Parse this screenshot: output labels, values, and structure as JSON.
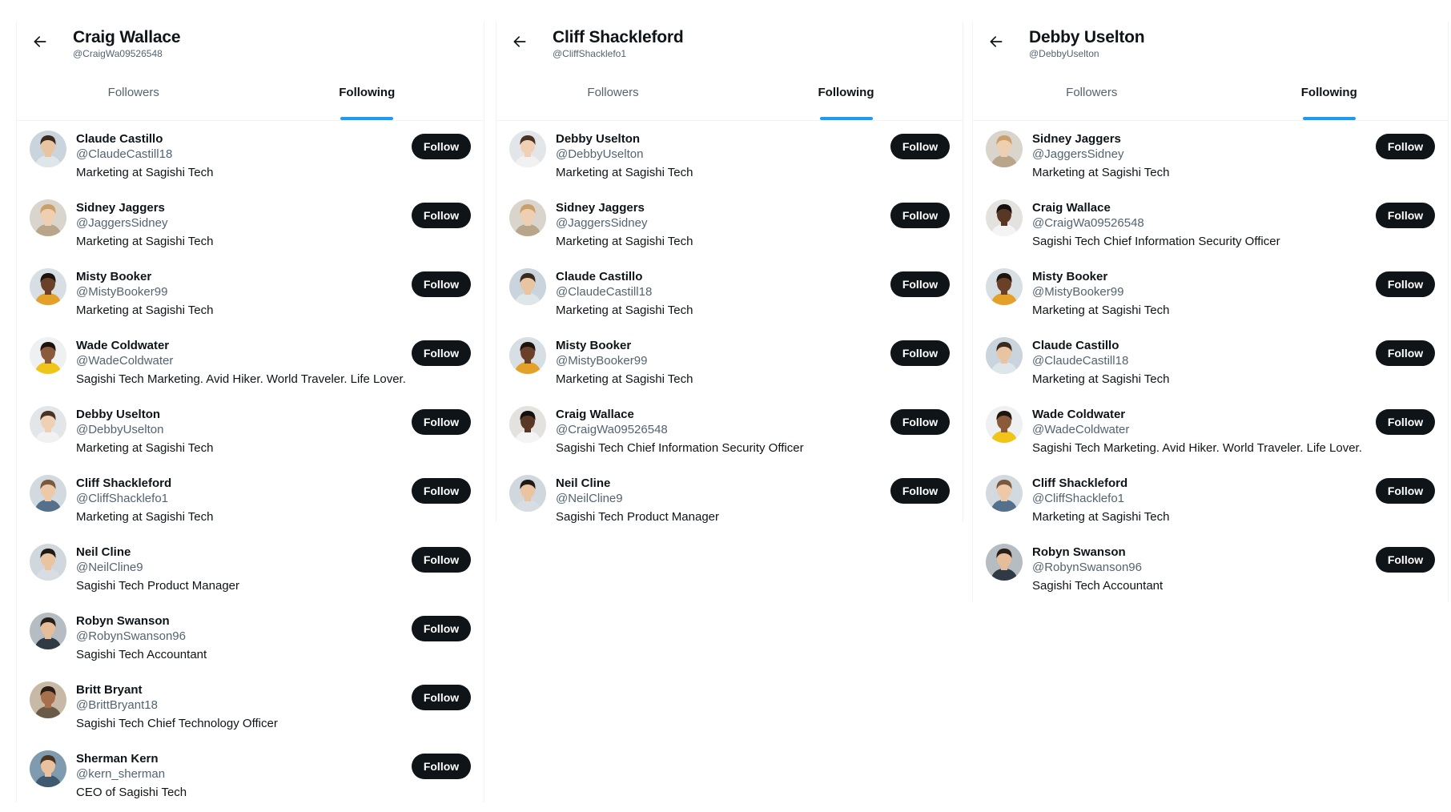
{
  "colors": {
    "accent": "#1d9bf0",
    "button_bg": "#0f1419",
    "muted_text": "#536471",
    "divider": "#eff3f4"
  },
  "panels": [
    {
      "name": "Craig Wallace",
      "handle": "@CraigWa09526548",
      "tabs": [
        {
          "label": "Followers",
          "active": false
        },
        {
          "label": "Following",
          "active": true
        }
      ],
      "users": [
        {
          "name": "Claude Castillo",
          "handle": "@ClaudeCastill18",
          "bio": "Marketing at Sagishi Tech",
          "button": "Follow",
          "avatar": {
            "skin": "#e8c4a0",
            "hair": "#3b2a1e",
            "bg": "#c9d4dc",
            "shirt": "#dfe6ea"
          }
        },
        {
          "name": "Sidney Jaggers",
          "handle": "@JaggersSidney",
          "bio": "Marketing at Sagishi Tech",
          "button": "Follow",
          "avatar": {
            "skin": "#efcfb2",
            "hair": "#c9a06a",
            "bg": "#d9d4cc",
            "shirt": "#b9a58a"
          }
        },
        {
          "name": "Misty Booker",
          "handle": "@MistyBooker99",
          "bio": "Marketing at Sagishi Tech",
          "button": "Follow",
          "avatar": {
            "skin": "#6b4028",
            "hair": "#1e140e",
            "bg": "#d8dfe4",
            "shirt": "#e3a12a"
          }
        },
        {
          "name": "Wade Coldwater",
          "handle": "@WadeColdwater",
          "bio": "Sagishi Tech Marketing. Avid Hiker. World Traveler. Life Lover.",
          "button": "Follow",
          "avatar": {
            "skin": "#8a5a3a",
            "hair": "#1e140e",
            "bg": "#eef0f2",
            "shirt": "#f0c419"
          }
        },
        {
          "name": "Debby Uselton",
          "handle": "@DebbyUselton",
          "bio": "Marketing at Sagishi Tech",
          "button": "Follow",
          "avatar": {
            "skin": "#f0d0b4",
            "hair": "#4a3224",
            "bg": "#e3e6e9",
            "shirt": "#f1f1f1"
          }
        },
        {
          "name": "Cliff Shackleford",
          "handle": "@CliffShacklefo1",
          "bio": "Marketing at Sagishi Tech",
          "button": "Follow",
          "avatar": {
            "skin": "#eec9a8",
            "hair": "#7a5a3c",
            "bg": "#d2dae0",
            "shirt": "#55708a"
          }
        },
        {
          "name": "Neil Cline",
          "handle": "@NeilCline9",
          "bio": "Sagishi Tech Product Manager",
          "button": "Follow",
          "avatar": {
            "skin": "#e9c49e",
            "hair": "#1f1a16",
            "bg": "#d0d8de",
            "shirt": "#d7dde2"
          }
        },
        {
          "name": "Robyn Swanson",
          "handle": "@RobynSwanson96",
          "bio": "Sagishi Tech Accountant",
          "button": "Follow",
          "avatar": {
            "skin": "#e6bd99",
            "hair": "#2a1f18",
            "bg": "#b5bcc2",
            "shirt": "#2f3a44"
          }
        },
        {
          "name": "Britt Bryant",
          "handle": "@BrittBryant18",
          "bio": "Sagishi Tech Chief Technology Officer",
          "button": "Follow",
          "avatar": {
            "skin": "#a86f4c",
            "hair": "#2a1d15",
            "bg": "#c7b9a6",
            "shirt": "#6b5a48"
          }
        },
        {
          "name": "Sherman Kern",
          "handle": "@kern_sherman",
          "bio": "CEO of Sagishi Tech",
          "button": "Follow",
          "avatar": {
            "skin": "#e8c29e",
            "hair": "#4a3322",
            "bg": "#7f9bb0",
            "shirt": "#3f5a70"
          }
        }
      ]
    },
    {
      "name": "Cliff Shackleford",
      "handle": "@CliffShacklefo1",
      "tabs": [
        {
          "label": "Followers",
          "active": false
        },
        {
          "label": "Following",
          "active": true
        }
      ],
      "users": [
        {
          "name": "Debby Uselton",
          "handle": "@DebbyUselton",
          "bio": "Marketing at Sagishi Tech",
          "button": "Follow",
          "avatar": {
            "skin": "#f0d0b4",
            "hair": "#4a3224",
            "bg": "#e3e6e9",
            "shirt": "#f1f1f1"
          }
        },
        {
          "name": "Sidney Jaggers",
          "handle": "@JaggersSidney",
          "bio": "Marketing at Sagishi Tech",
          "button": "Follow",
          "avatar": {
            "skin": "#efcfb2",
            "hair": "#c9a06a",
            "bg": "#d9d4cc",
            "shirt": "#b9a58a"
          }
        },
        {
          "name": "Claude Castillo",
          "handle": "@ClaudeCastill18",
          "bio": "Marketing at Sagishi Tech",
          "button": "Follow",
          "avatar": {
            "skin": "#e8c4a0",
            "hair": "#3b2a1e",
            "bg": "#c9d4dc",
            "shirt": "#dfe6ea"
          }
        },
        {
          "name": "Misty Booker",
          "handle": "@MistyBooker99",
          "bio": "Marketing at Sagishi Tech",
          "button": "Follow",
          "avatar": {
            "skin": "#6b4028",
            "hair": "#1e140e",
            "bg": "#d8dfe4",
            "shirt": "#e3a12a"
          }
        },
        {
          "name": "Craig Wallace",
          "handle": "@CraigWa09526548",
          "bio": "Sagishi Tech Chief Information Security Officer",
          "button": "Follow",
          "avatar": {
            "skin": "#5a3624",
            "hair": "#151010",
            "bg": "#e4e2de",
            "shirt": "#f4f4f4"
          }
        },
        {
          "name": "Neil Cline",
          "handle": "@NeilCline9",
          "bio": "Sagishi Tech Product Manager",
          "button": "Follow",
          "avatar": {
            "skin": "#e9c49e",
            "hair": "#1f1a16",
            "bg": "#d0d8de",
            "shirt": "#d7dde2"
          }
        }
      ]
    },
    {
      "name": "Debby Uselton",
      "handle": "@DebbyUselton",
      "tabs": [
        {
          "label": "Followers",
          "active": false
        },
        {
          "label": "Following",
          "active": true
        }
      ],
      "users": [
        {
          "name": "Sidney Jaggers",
          "handle": "@JaggersSidney",
          "bio": "Marketing at Sagishi Tech",
          "button": "Follow",
          "avatar": {
            "skin": "#efcfb2",
            "hair": "#c9a06a",
            "bg": "#d9d4cc",
            "shirt": "#b9a58a"
          }
        },
        {
          "name": "Craig Wallace",
          "handle": "@CraigWa09526548",
          "bio": "Sagishi Tech Chief Information Security Officer",
          "button": "Follow",
          "avatar": {
            "skin": "#5a3624",
            "hair": "#151010",
            "bg": "#e4e2de",
            "shirt": "#f4f4f4"
          }
        },
        {
          "name": "Misty Booker",
          "handle": "@MistyBooker99",
          "bio": "Marketing at Sagishi Tech",
          "button": "Follow",
          "avatar": {
            "skin": "#6b4028",
            "hair": "#1e140e",
            "bg": "#d8dfe4",
            "shirt": "#e3a12a"
          }
        },
        {
          "name": "Claude Castillo",
          "handle": "@ClaudeCastill18",
          "bio": "Marketing at Sagishi Tech",
          "button": "Follow",
          "avatar": {
            "skin": "#e8c4a0",
            "hair": "#3b2a1e",
            "bg": "#c9d4dc",
            "shirt": "#dfe6ea"
          }
        },
        {
          "name": "Wade Coldwater",
          "handle": "@WadeColdwater",
          "bio": "Sagishi Tech Marketing. Avid Hiker. World Traveler. Life Lover.",
          "button": "Follow",
          "avatar": {
            "skin": "#8a5a3a",
            "hair": "#1e140e",
            "bg": "#eef0f2",
            "shirt": "#f0c419"
          }
        },
        {
          "name": "Cliff Shackleford",
          "handle": "@CliffShacklefo1",
          "bio": "Marketing at Sagishi Tech",
          "button": "Follow",
          "avatar": {
            "skin": "#eec9a8",
            "hair": "#7a5a3c",
            "bg": "#d2dae0",
            "shirt": "#55708a"
          }
        },
        {
          "name": "Robyn Swanson",
          "handle": "@RobynSwanson96",
          "bio": "Sagishi Tech Accountant",
          "button": "Follow",
          "avatar": {
            "skin": "#e6bd99",
            "hair": "#2a1f18",
            "bg": "#b5bcc2",
            "shirt": "#2f3a44"
          }
        }
      ]
    }
  ]
}
